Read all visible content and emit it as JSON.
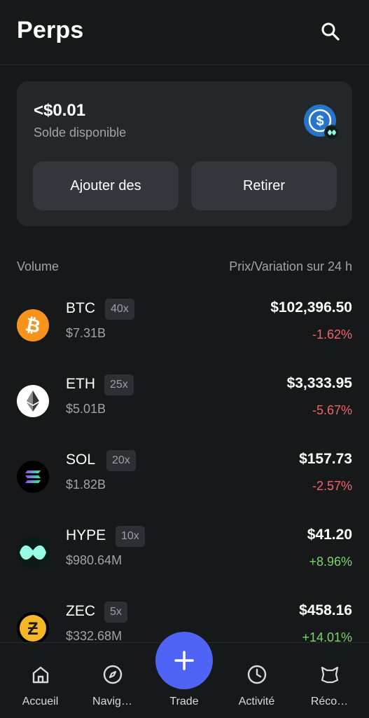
{
  "header": {
    "title": "Perps"
  },
  "balance": {
    "amount": "<$0.01",
    "label": "Solde disponible",
    "add_label": "Ajouter des",
    "withdraw_label": "Retirer"
  },
  "columns": {
    "left": "Volume",
    "right": "Prix/Variation sur 24 h"
  },
  "markets": [
    {
      "symbol": "BTC",
      "leverage": "40x",
      "volume": "$7.31B",
      "price": "$102,396.50",
      "change": "-1.62%",
      "direction": "down",
      "icon": "bitcoin-icon",
      "color": "#f7931a"
    },
    {
      "symbol": "ETH",
      "leverage": "25x",
      "volume": "$5.01B",
      "price": "$3,333.95",
      "change": "-5.67%",
      "direction": "down",
      "icon": "ethereum-icon",
      "color": "#ffffff"
    },
    {
      "symbol": "SOL",
      "leverage": "20x",
      "volume": "$1.82B",
      "price": "$157.73",
      "change": "-2.57%",
      "direction": "down",
      "icon": "solana-icon",
      "color": "#000000"
    },
    {
      "symbol": "HYPE",
      "leverage": "10x",
      "volume": "$980.64M",
      "price": "$41.20",
      "change": "+8.96%",
      "direction": "up",
      "icon": "hyperliquid-icon",
      "color": "#97fce4"
    },
    {
      "symbol": "ZEC",
      "leverage": "5x",
      "volume": "$332.68M",
      "price": "$458.16",
      "change": "+14.01%",
      "direction": "up",
      "icon": "zcash-icon",
      "color": "#f4b728"
    }
  ],
  "nav": {
    "home": "Accueil",
    "explore": "Navig…",
    "trade": "Trade",
    "activity": "Activité",
    "rewards": "Réco…"
  },
  "colors": {
    "background": "#16181a",
    "card": "#24272a",
    "accent": "#4f63f5",
    "negative": "#f2646a",
    "positive": "#7fd36a"
  }
}
